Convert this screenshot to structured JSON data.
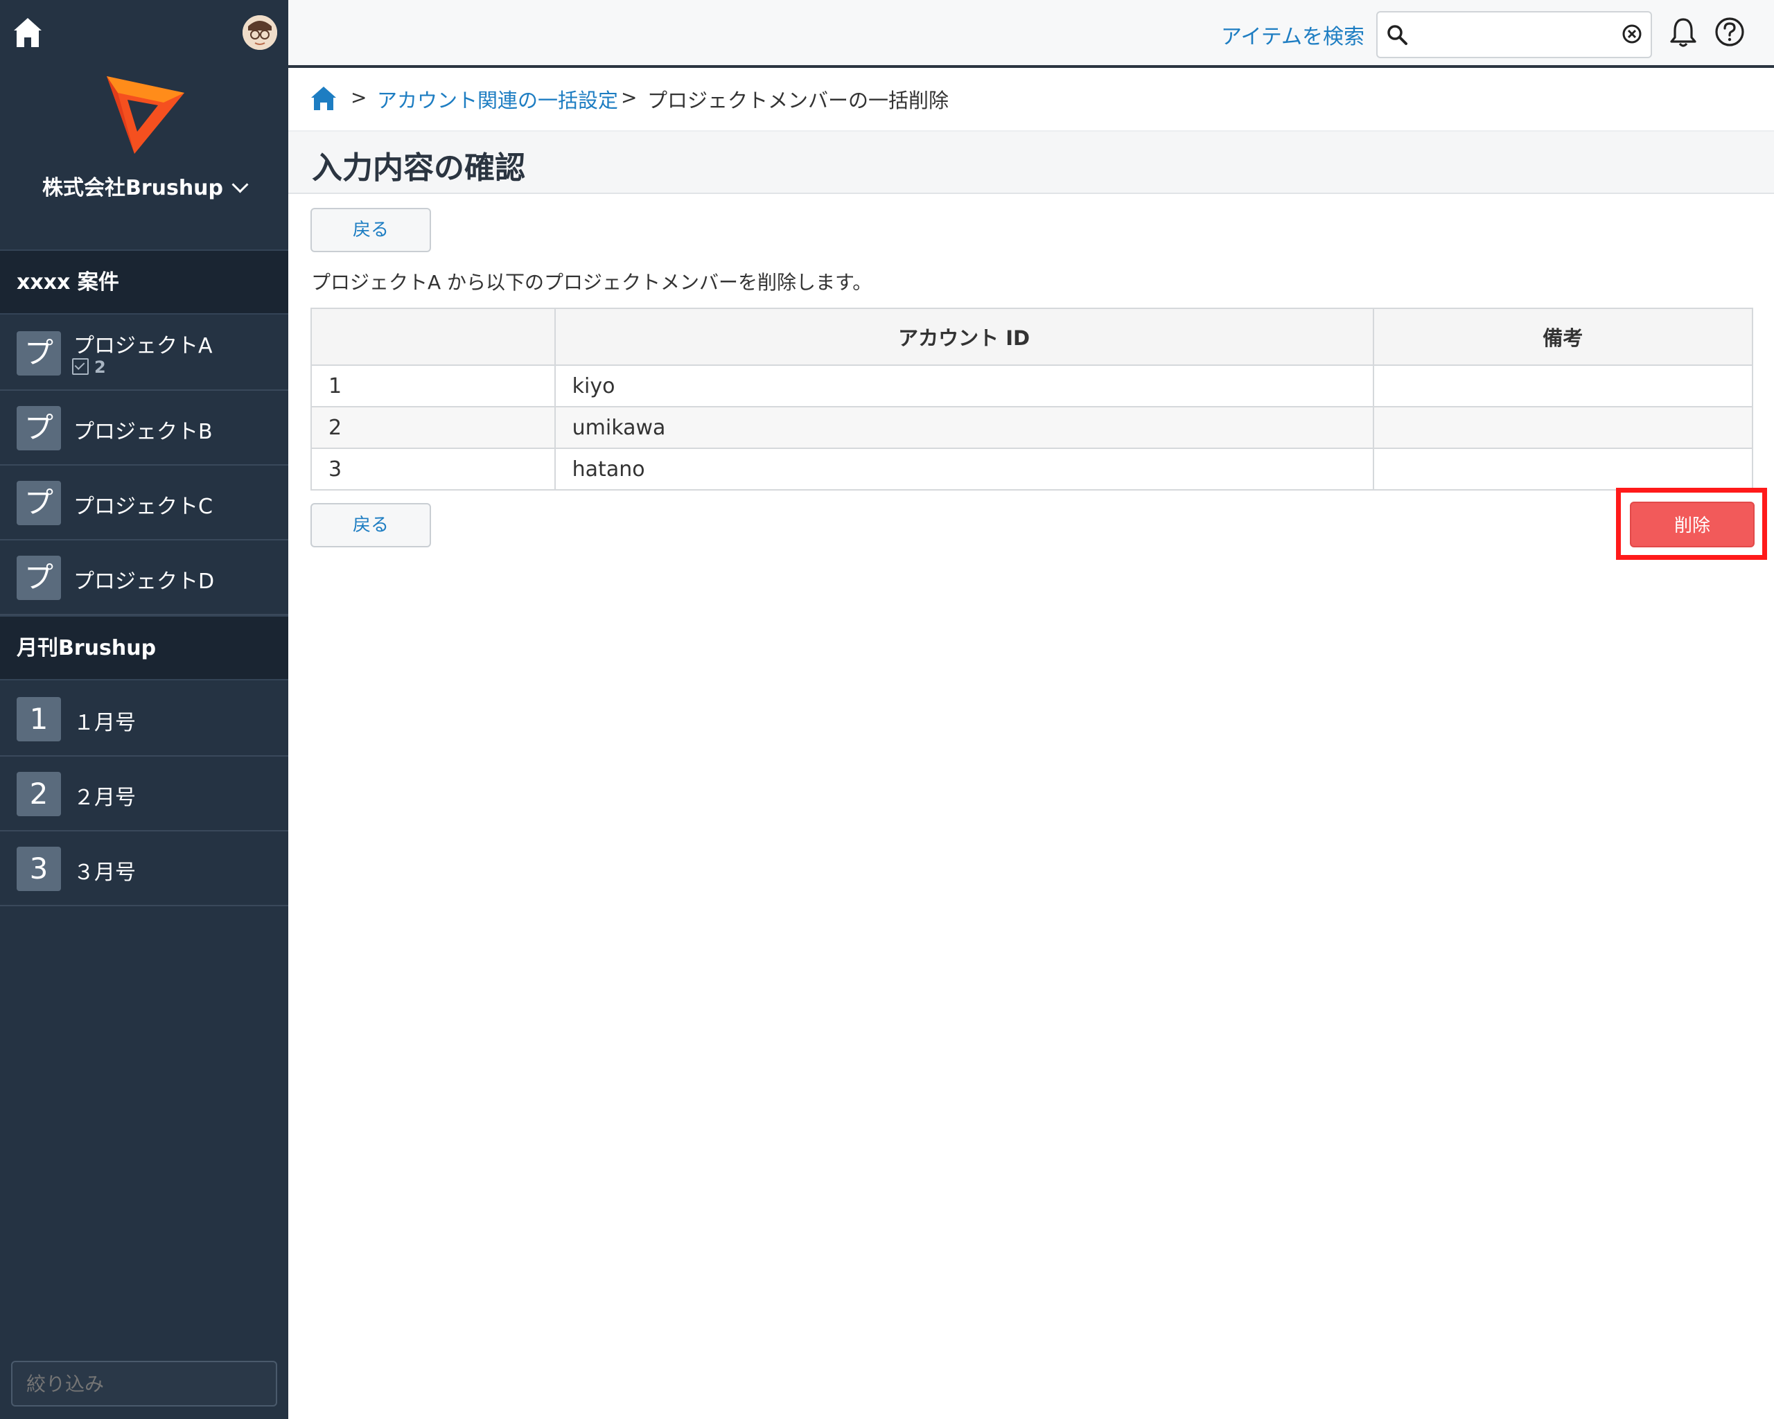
{
  "sidebar": {
    "company": "株式会社Brushup",
    "sections": [
      {
        "title": "xxxx 案件",
        "items": [
          {
            "badge": "プ",
            "label": "プロジェクトA",
            "sub": "2"
          },
          {
            "badge": "プ",
            "label": "プロジェクトB"
          },
          {
            "badge": "プ",
            "label": "プロジェクトC"
          },
          {
            "badge": "プ",
            "label": "プロジェクトD"
          }
        ]
      },
      {
        "title": "月刊Brushup",
        "items": [
          {
            "badge": "1",
            "label": "１月号"
          },
          {
            "badge": "2",
            "label": "２月号"
          },
          {
            "badge": "3",
            "label": "３月号"
          }
        ]
      }
    ],
    "filter_placeholder": "絞り込み"
  },
  "topbar": {
    "search_label": "アイテムを検索",
    "search_value": ""
  },
  "breadcrumb": {
    "separator": ">",
    "link": "アカウント関連の一括設定",
    "current": "プロジェクトメンバーの一括削除"
  },
  "page": {
    "title": "入力内容の確認",
    "back_label": "戻る",
    "description": "プロジェクトA から以下のプロジェクトメンバーを削除します。",
    "delete_label": "削除"
  },
  "table": {
    "headers": [
      "",
      "アカウント ID",
      "備考"
    ],
    "rows": [
      [
        "1",
        "kiyo",
        ""
      ],
      [
        "2",
        "umikawa",
        ""
      ],
      [
        "3",
        "hatano",
        ""
      ]
    ]
  },
  "colors": {
    "sidebar_bg": "#253343",
    "accent_link": "#1d7dc2",
    "delete_button": "#f25a5a",
    "highlight_border": "#ff1a1a"
  }
}
